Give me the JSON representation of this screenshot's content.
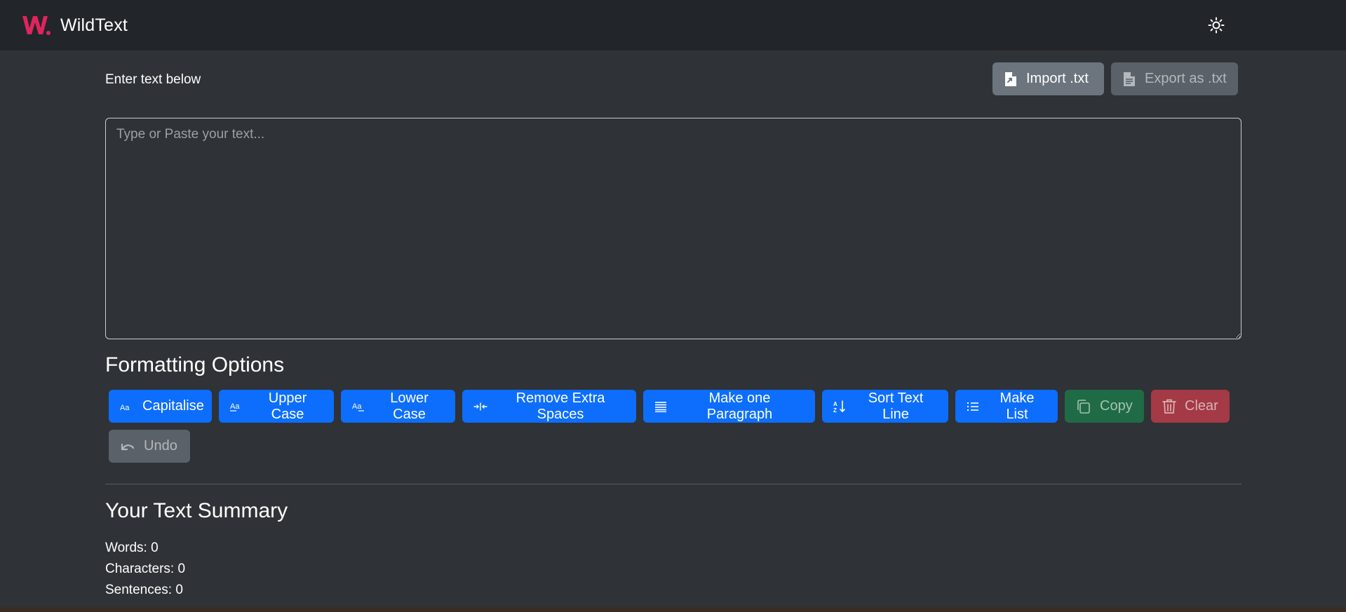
{
  "app": {
    "name": "WildText",
    "logo_text": "W."
  },
  "header": {
    "theme_toggle_icon": "sun-icon"
  },
  "editor": {
    "label": "Enter text below",
    "import_label": "Import .txt",
    "export_label": "Export as .txt",
    "placeholder": "Type or Paste your text...",
    "value": ""
  },
  "formatting": {
    "title": "Formatting Options",
    "capitalise": "Capitalise",
    "upper": "Upper Case",
    "lower": "Lower Case",
    "remove_spaces": "Remove Extra Spaces",
    "one_paragraph": "Make one Paragraph",
    "sort_lines": "Sort Text Line",
    "make_list": "Make List",
    "copy": "Copy",
    "clear": "Clear",
    "undo": "Undo"
  },
  "summary": {
    "title": "Your Text Summary",
    "words": "Words: 0",
    "characters": "Characters: 0",
    "sentences": "Sentences: 0"
  },
  "colors": {
    "brand": "#e0245e",
    "primary": "#0d6efd",
    "secondary": "#6c757d",
    "success": "#1f6b45",
    "danger": "#a33a45",
    "background": "#2f3237",
    "navbar": "#22252a"
  }
}
